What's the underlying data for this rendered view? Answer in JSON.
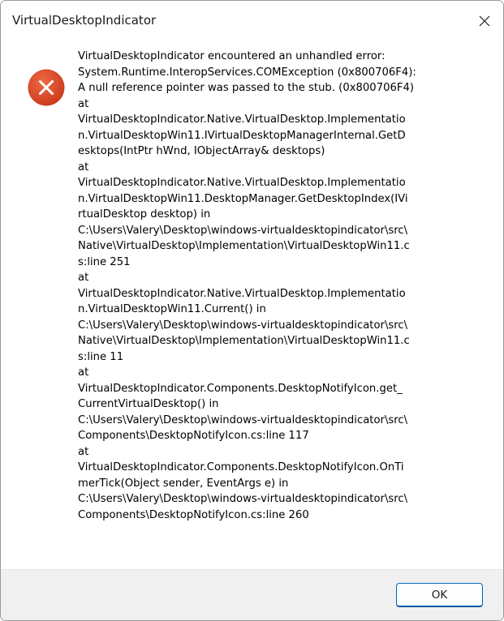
{
  "window": {
    "title": "VirtualDesktopIndicator",
    "close_icon": "close-icon"
  },
  "dialog": {
    "icon": "error-icon",
    "icon_color": "#d8431f",
    "message": "VirtualDesktopIndicator encountered an unhandled error:\nSystem.Runtime.InteropServices.COMException (0x800706F4):\nA null reference pointer was passed to the stub. (0x800706F4)\n   at\nVirtualDesktopIndicator.Native.VirtualDesktop.Implementatio\nn.VirtualDesktopWin11.IVirtualDesktopManagerInternal.GetD\nesktops(IntPtr hWnd, IObjectArray& desktops)\n   at\nVirtualDesktopIndicator.Native.VirtualDesktop.Implementatio\nn.VirtualDesktopWin11.DesktopManager.GetDesktopIndex(IVi\nrtualDesktop desktop) in\nC:\\Users\\Valery\\Desktop\\windows-virtualdesktopindicator\\src\\\nNative\\VirtualDesktop\\Implementation\\VirtualDesktopWin11.c\ns:line 251\n   at\nVirtualDesktopIndicator.Native.VirtualDesktop.Implementatio\nn.VirtualDesktopWin11.Current() in\nC:\\Users\\Valery\\Desktop\\windows-virtualdesktopindicator\\src\\\nNative\\VirtualDesktop\\Implementation\\VirtualDesktopWin11.c\ns:line 11\n   at\nVirtualDesktopIndicator.Components.DesktopNotifyIcon.get_\nCurrentVirtualDesktop() in\nC:\\Users\\Valery\\Desktop\\windows-virtualdesktopindicator\\src\\\nComponents\\DesktopNotifyIcon.cs:line 117\n   at\nVirtualDesktopIndicator.Components.DesktopNotifyIcon.OnTi\nmerTick(Object sender, EventArgs e) in\nC:\\Users\\Valery\\Desktop\\windows-virtualdesktopindicator\\src\\\nComponents\\DesktopNotifyIcon.cs:line 260"
  },
  "footer": {
    "ok_label": "OK",
    "accent": "#0067c0"
  }
}
